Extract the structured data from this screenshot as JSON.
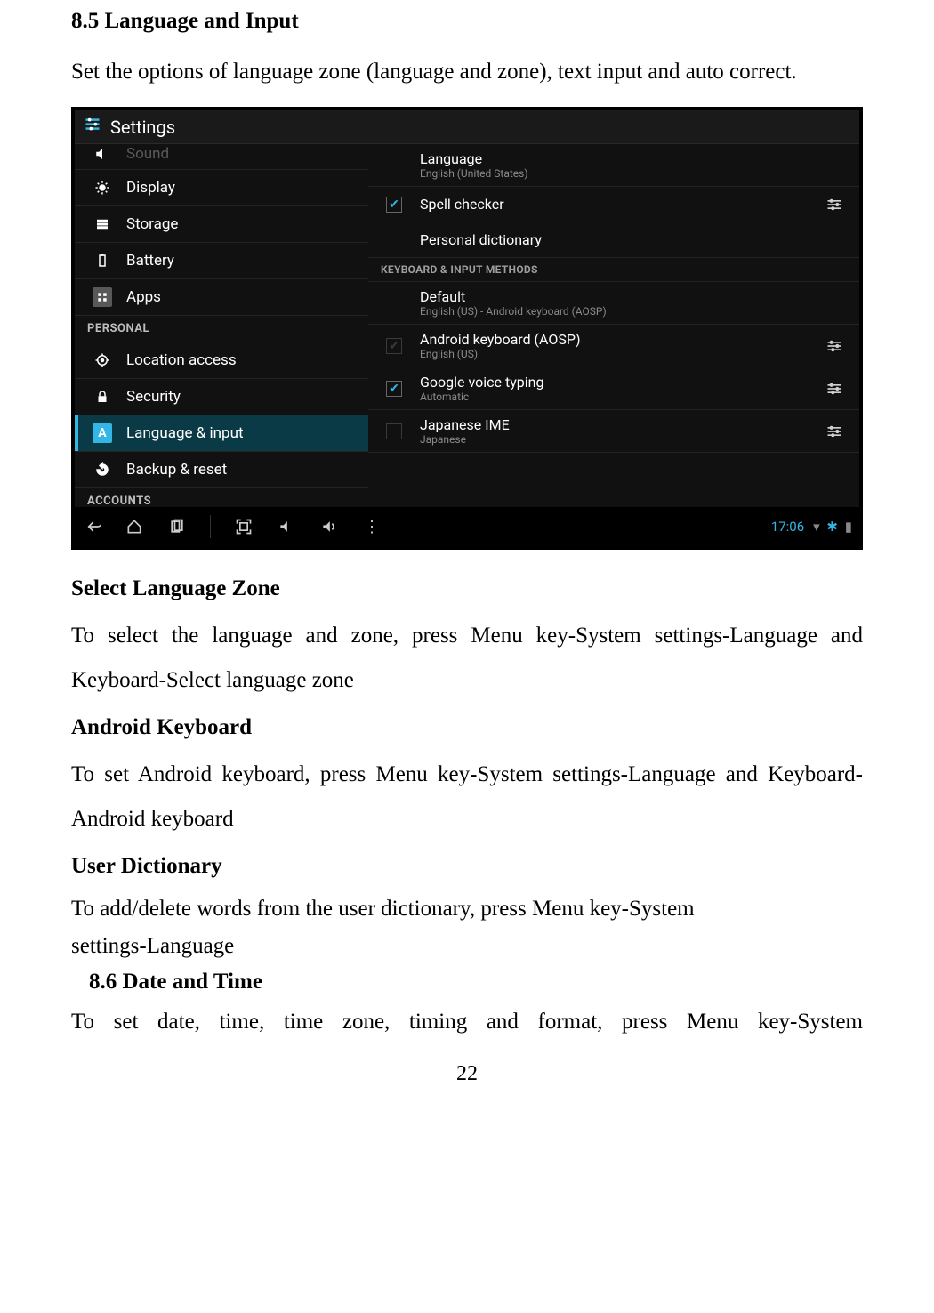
{
  "doc": {
    "section": "8.5 Language and Input",
    "intro": "Set the options of language zone (language and zone), text input and auto correct.",
    "h1": "Select Language Zone",
    "p1": "To select the language and zone, press Menu key-System settings-Language and Keyboard-Select language zone",
    "h2": "Android Keyboard",
    "p2": "To set Android keyboard, press Menu key-System settings-Language and Keyboard-Android keyboard",
    "h3": "User Dictionary",
    "p3a": "To add/delete words from the user dictionary, press Menu key-System",
    "p3b": "settings-Language",
    "section2": "8.6 Date and Time",
    "p4": "To set date, time, time zone, timing and format, press Menu key-System",
    "page": "22"
  },
  "shot": {
    "title": "Settings",
    "sidebar": {
      "items": [
        {
          "label": "Sound",
          "icon": "speaker"
        },
        {
          "label": "Display",
          "icon": "display"
        },
        {
          "label": "Storage",
          "icon": "storage"
        },
        {
          "label": "Battery",
          "icon": "battery"
        },
        {
          "label": "Apps",
          "icon": "apps"
        }
      ],
      "cat1": "PERSONAL",
      "personal": [
        {
          "label": "Location access",
          "icon": "location"
        },
        {
          "label": "Security",
          "icon": "lock"
        },
        {
          "label": "Language & input",
          "icon": "A",
          "active": true
        },
        {
          "label": "Backup & reset",
          "icon": "backup"
        }
      ],
      "cat2": "ACCOUNTS"
    },
    "right": {
      "rows": [
        {
          "type": "item",
          "t1": "Language",
          "t2": "English (United States)"
        },
        {
          "type": "check",
          "checked": true,
          "t1": "Spell checker",
          "gear": true
        },
        {
          "type": "item",
          "t1": "Personal dictionary"
        },
        {
          "type": "cat",
          "label": "KEYBOARD & INPUT METHODS"
        },
        {
          "type": "item",
          "t1": "Default",
          "t2": "English (US) - Android keyboard (AOSP)"
        },
        {
          "type": "check",
          "checked": true,
          "disabled": true,
          "t1": "Android keyboard (AOSP)",
          "t2": "English (US)",
          "gear": true
        },
        {
          "type": "check",
          "checked": true,
          "t1": "Google voice typing",
          "t2": "Automatic",
          "gear": true
        },
        {
          "type": "check",
          "checked": false,
          "disabled": true,
          "t1": "Japanese IME",
          "t2": "Japanese",
          "gear": true
        }
      ]
    },
    "navbar": {
      "time": "17:06"
    }
  }
}
